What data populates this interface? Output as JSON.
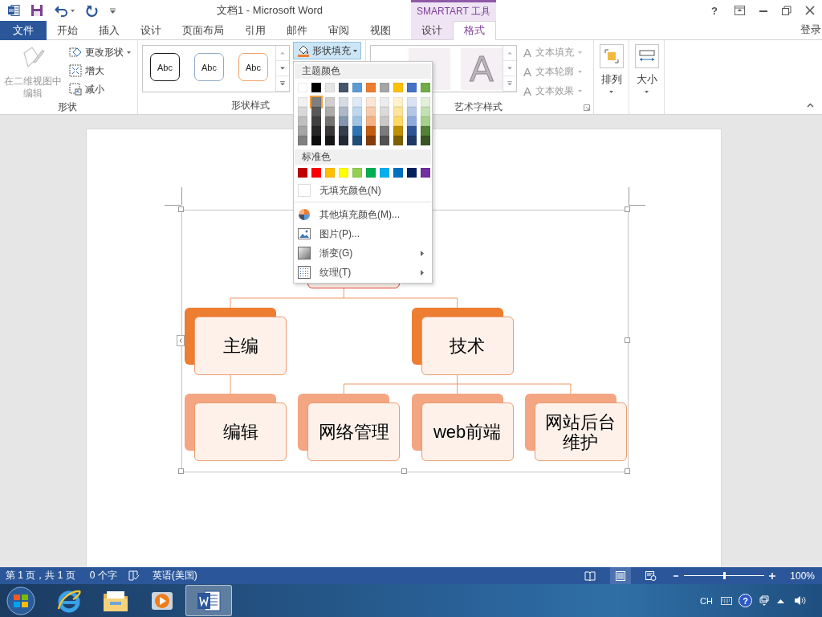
{
  "title_bar": {
    "title": "文档1 - Microsoft Word",
    "context_group": "SMARTART 工具",
    "help": "?"
  },
  "tabs": [
    {
      "label": "文件",
      "kind": "file",
      "selected": false
    },
    {
      "label": "开始",
      "kind": "normal",
      "selected": false
    },
    {
      "label": "插入",
      "kind": "normal",
      "selected": false
    },
    {
      "label": "设计",
      "kind": "normal",
      "selected": false
    },
    {
      "label": "页面布局",
      "kind": "normal",
      "selected": false
    },
    {
      "label": "引用",
      "kind": "normal",
      "selected": false
    },
    {
      "label": "邮件",
      "kind": "normal",
      "selected": false
    },
    {
      "label": "审阅",
      "kind": "normal",
      "selected": false
    },
    {
      "label": "视图",
      "kind": "normal",
      "selected": false
    },
    {
      "label": "设计",
      "kind": "context",
      "selected": false
    },
    {
      "label": "格式",
      "kind": "context",
      "selected": true
    }
  ],
  "account": "登录",
  "ribbon": {
    "shape": {
      "label": "形状",
      "edit_button": {
        "label": "在二维视图中编辑",
        "disabled": true
      },
      "buttons": [
        {
          "label": "更改形状",
          "dropdown": true
        },
        {
          "label": "增大",
          "dropdown": false
        },
        {
          "label": "减小",
          "dropdown": false
        }
      ]
    },
    "shape_styles": {
      "label": "形状样式",
      "gallery": [
        {
          "label": "Abc",
          "color": "#1a1a1a"
        },
        {
          "label": "Abc",
          "color": "#8eaac8"
        },
        {
          "label": "Abc",
          "color": "#f2a36b"
        }
      ],
      "fill_button": {
        "label": "形状填充",
        "expanded": true
      }
    },
    "wordart_styles": {
      "label": "艺术字样式",
      "gallery": [
        {
          "label": "A"
        }
      ],
      "buttons": [
        {
          "icon": "A",
          "label": "文本填充",
          "disabled": true
        },
        {
          "icon": "A",
          "label": "文本轮廓",
          "disabled": true
        },
        {
          "icon": "A",
          "label": "文本效果",
          "disabled": true
        }
      ]
    },
    "arrange": {
      "label": "排列"
    },
    "size": {
      "label": "大小"
    }
  },
  "fill_menu": {
    "theme_heading": "主题颜色",
    "theme_colors": [
      {
        "color": "#ffffff",
        "selected": false,
        "shades": [
          {
            "color": "#f2f2f2",
            "selected": false
          },
          {
            "color": "#d9d9d9",
            "selected": false
          },
          {
            "color": "#bfbfbf",
            "selected": false
          },
          {
            "color": "#a6a6a6",
            "selected": false
          },
          {
            "color": "#808080",
            "selected": false
          }
        ]
      },
      {
        "color": "#000000",
        "selected": false,
        "shades": [
          {
            "color": "#7f7f7f",
            "selected": true
          },
          {
            "color": "#595959",
            "selected": false
          },
          {
            "color": "#404040",
            "selected": false
          },
          {
            "color": "#262626",
            "selected": false
          },
          {
            "color": "#0d0d0d",
            "selected": false
          }
        ]
      },
      {
        "color": "#e7e6e6",
        "selected": false,
        "shades": [
          {
            "color": "#d0cece",
            "selected": false
          },
          {
            "color": "#aeabab",
            "selected": false
          },
          {
            "color": "#757171",
            "selected": false
          },
          {
            "color": "#3a3838",
            "selected": false
          },
          {
            "color": "#161616",
            "selected": false
          }
        ]
      },
      {
        "color": "#44546a",
        "selected": false,
        "shades": [
          {
            "color": "#d6dce4",
            "selected": false
          },
          {
            "color": "#adb9ca",
            "selected": false
          },
          {
            "color": "#8496b0",
            "selected": false
          },
          {
            "color": "#333f4f",
            "selected": false
          },
          {
            "color": "#222a35",
            "selected": false
          }
        ]
      },
      {
        "color": "#5b9bd5",
        "selected": false,
        "shades": [
          {
            "color": "#deebf6",
            "selected": false
          },
          {
            "color": "#bdd7ee",
            "selected": false
          },
          {
            "color": "#9dc3e6",
            "selected": false
          },
          {
            "color": "#2e75b5",
            "selected": false
          },
          {
            "color": "#1f4e79",
            "selected": false
          }
        ]
      },
      {
        "color": "#ed7d31",
        "selected": false,
        "shades": [
          {
            "color": "#fbe5d5",
            "selected": false
          },
          {
            "color": "#f7cbac",
            "selected": false
          },
          {
            "color": "#f4b183",
            "selected": false
          },
          {
            "color": "#c55a11",
            "selected": false
          },
          {
            "color": "#843c0b",
            "selected": false
          }
        ]
      },
      {
        "color": "#a5a5a5",
        "selected": false,
        "shades": [
          {
            "color": "#ededed",
            "selected": false
          },
          {
            "color": "#dbdbdb",
            "selected": false
          },
          {
            "color": "#c9c9c9",
            "selected": false
          },
          {
            "color": "#7b7b7b",
            "selected": false
          },
          {
            "color": "#525252",
            "selected": false
          }
        ]
      },
      {
        "color": "#ffc000",
        "selected": false,
        "shades": [
          {
            "color": "#fff2cc",
            "selected": false
          },
          {
            "color": "#fee599",
            "selected": false
          },
          {
            "color": "#ffd965",
            "selected": false
          },
          {
            "color": "#bf9000",
            "selected": false
          },
          {
            "color": "#7f6000",
            "selected": false
          }
        ]
      },
      {
        "color": "#4472c4",
        "selected": false,
        "shades": [
          {
            "color": "#dae3f3",
            "selected": false
          },
          {
            "color": "#b4c7e7",
            "selected": false
          },
          {
            "color": "#8faadc",
            "selected": false
          },
          {
            "color": "#2f5496",
            "selected": false
          },
          {
            "color": "#1f3864",
            "selected": false
          }
        ]
      },
      {
        "color": "#70ad47",
        "selected": false,
        "shades": [
          {
            "color": "#e2efd9",
            "selected": false
          },
          {
            "color": "#c5e0b3",
            "selected": false
          },
          {
            "color": "#a8d08d",
            "selected": false
          },
          {
            "color": "#538135",
            "selected": false
          },
          {
            "color": "#375623",
            "selected": false
          }
        ]
      }
    ],
    "standard_heading": "标准色",
    "standard_colors": [
      {
        "color": "#c00000",
        "selected": false
      },
      {
        "color": "#ff0000",
        "selected": false
      },
      {
        "color": "#ffc000",
        "selected": false
      },
      {
        "color": "#ffff00",
        "selected": false
      },
      {
        "color": "#92d050",
        "selected": false
      },
      {
        "color": "#00b050",
        "selected": false
      },
      {
        "color": "#00b0f0",
        "selected": false
      },
      {
        "color": "#0070c0",
        "selected": false
      },
      {
        "color": "#002060",
        "selected": false
      },
      {
        "color": "#7030a0",
        "selected": false
      }
    ],
    "items": [
      {
        "kind": "no_fill",
        "label": "无填充颜色(N)",
        "submenu": false
      },
      {
        "kind": "more_colors",
        "label": "其他填充颜色(M)...",
        "submenu": false
      },
      {
        "kind": "picture",
        "label": "图片(P)...",
        "submenu": false
      },
      {
        "kind": "gradient",
        "label": "渐变(G)",
        "submenu": true
      },
      {
        "kind": "texture",
        "label": "纹理(T)",
        "submenu": true
      }
    ]
  },
  "diagram": {
    "root": {
      "children": [
        {
          "text": "主编",
          "children": [
            {
              "text": "编辑"
            }
          ]
        },
        {
          "text": "技术",
          "children": [
            {
              "text": "网络管理"
            },
            {
              "text": "web前端"
            },
            {
              "text": "网站后台维护"
            }
          ]
        }
      ]
    }
  },
  "status_bar": {
    "page": "第 1 页，共 1 页",
    "words": "0 个字",
    "language": "英语(美国)",
    "views": [
      {
        "kind": "read",
        "selected": false
      },
      {
        "kind": "print",
        "selected": true
      },
      {
        "kind": "web",
        "selected": false
      }
    ],
    "zoom_slider": {
      "level": 0.5
    },
    "zoom": "100%"
  },
  "taskbar": {
    "apps": [
      {
        "kind": "browser",
        "selected": false
      },
      {
        "kind": "folder",
        "selected": false
      },
      {
        "kind": "media",
        "selected": false
      },
      {
        "kind": "word",
        "selected": true
      }
    ],
    "input_language": "CH",
    "help": "?"
  }
}
